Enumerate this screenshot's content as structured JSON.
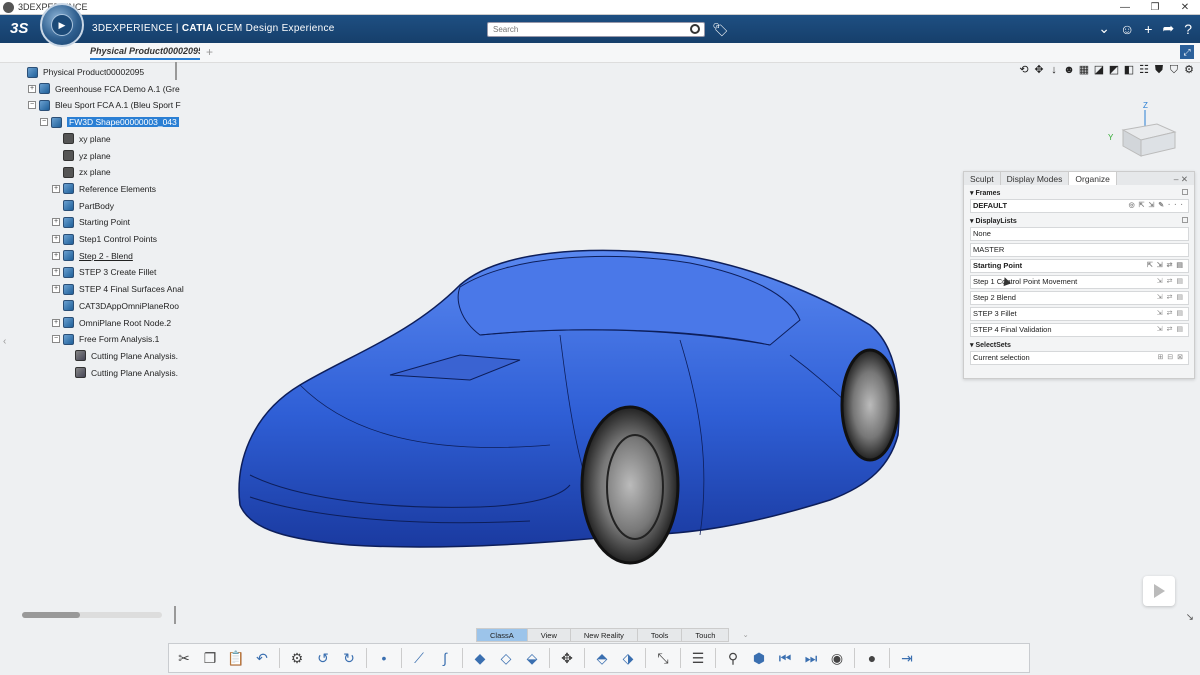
{
  "window": {
    "title": "3DEXPERIENCE",
    "controls": [
      "—",
      "❐",
      "✕"
    ]
  },
  "topbar": {
    "brand_plain": "3DEXPERIENCE | ",
    "brand_bold": "CATIA",
    "brand_rest": " ICEM Design Experience",
    "search_placeholder": "Search",
    "ds_logo": "3S",
    "icons": [
      "chevron-down-icon",
      "user-icon",
      "plus-icon",
      "share-icon",
      "help-icon"
    ]
  },
  "tabbar": {
    "doc_tab": "Physical Product00002095",
    "add": "+"
  },
  "tree": [
    {
      "label": "Physical Product00002095",
      "level": 0,
      "icon": "product",
      "exp": ""
    },
    {
      "label": "Greenhouse FCA Demo A.1 (Gre",
      "level": 1,
      "icon": "product",
      "exp": "+"
    },
    {
      "label": "Bleu Sport FCA A.1 (Bleu Sport F",
      "level": 1,
      "icon": "product",
      "exp": "−"
    },
    {
      "label": "FW3D Shape00000003_043",
      "level": 2,
      "icon": "shape",
      "exp": "−",
      "selected": true
    },
    {
      "label": "xy plane",
      "level": 3,
      "icon": "plane",
      "exp": ""
    },
    {
      "label": "yz plane",
      "level": 3,
      "icon": "plane",
      "exp": ""
    },
    {
      "label": "zx plane",
      "level": 3,
      "icon": "plane",
      "exp": ""
    },
    {
      "label": "Reference Elements",
      "level": 3,
      "icon": "set",
      "exp": "+"
    },
    {
      "label": "PartBody",
      "level": 3,
      "icon": "set",
      "exp": ""
    },
    {
      "label": "Starting Point",
      "level": 3,
      "icon": "set",
      "exp": "+"
    },
    {
      "label": "Step1 Control Points",
      "level": 3,
      "icon": "set",
      "exp": "+"
    },
    {
      "label": "Step 2 - Blend",
      "level": 3,
      "icon": "set",
      "exp": "+",
      "underline": true
    },
    {
      "label": "STEP 3 Create Fillet",
      "level": 3,
      "icon": "set",
      "exp": "+"
    },
    {
      "label": "STEP 4 Final Surfaces Anal",
      "level": 3,
      "icon": "set",
      "exp": "+"
    },
    {
      "label": "CAT3DAppOmniPlaneRoo",
      "level": 3,
      "icon": "set",
      "exp": ""
    },
    {
      "label": "OmniPlane Root Node.2",
      "level": 3,
      "icon": "set",
      "exp": "+"
    },
    {
      "label": "Free Form Analysis.1",
      "level": 3,
      "icon": "set",
      "exp": "−"
    },
    {
      "label": "Cutting Plane Analysis.",
      "level": 4,
      "icon": "cut",
      "exp": ""
    },
    {
      "label": "Cutting Plane Analysis.",
      "level": 4,
      "icon": "cut",
      "exp": ""
    }
  ],
  "panel": {
    "tabs": [
      "Sculpt",
      "Display Modes",
      "Organize"
    ],
    "active_tab": "Organize",
    "frames_title": "Frames",
    "frames": [
      {
        "label": "DEFAULT",
        "bold": true,
        "icons": "◎   ⇱ ⇲      ✎ · · ·"
      }
    ],
    "displaylists_title": "DisplayLists",
    "displaylists": [
      {
        "label": "None",
        "bold": false,
        "icons": ""
      },
      {
        "label": "MASTER",
        "bold": false,
        "icons": ""
      },
      {
        "label": "Starting Point",
        "bold": true,
        "icons": "⇱ ⇲ ⇄    ▤"
      },
      {
        "label": "Step 1 Control Point Movement",
        "bold": false,
        "icons": "⇲ ⇄    ▤"
      },
      {
        "label": "Step 2 Blend",
        "bold": false,
        "icons": "⇲ ⇄    ▤"
      },
      {
        "label": "STEP 3 Fillet",
        "bold": false,
        "icons": "⇲ ⇄    ▤"
      },
      {
        "label": "STEP 4 Final Validation",
        "bold": false,
        "icons": "⇲ ⇄    ▤"
      }
    ],
    "selectsets_title": "SelectSets",
    "selectsets": [
      {
        "label": "Current selection",
        "bold": false,
        "icons": "⊞ ⊟ ⊠"
      }
    ]
  },
  "bottom_tabs": [
    "ClassA",
    "View",
    "New Reality",
    "Tools",
    "Touch"
  ],
  "active_bottom_tab": "ClassA",
  "viewcube": {
    "z": "Z",
    "y": "Y"
  },
  "colors": {
    "topbar": "#1e4f82",
    "accent": "#2a7fd4",
    "car": "#2f5fd6"
  }
}
